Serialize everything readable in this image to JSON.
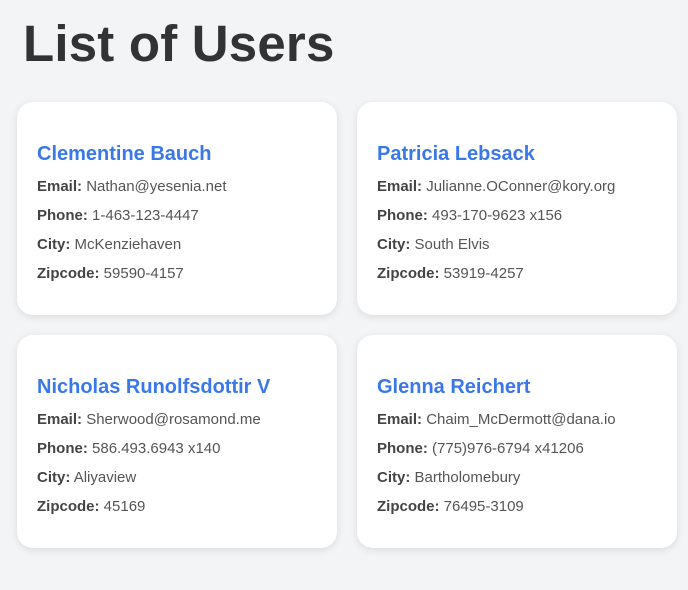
{
  "page": {
    "title": "List of Users"
  },
  "labels": {
    "email": "Email:",
    "phone": "Phone:",
    "city": "City:",
    "zipcode": "Zipcode:"
  },
  "users": [
    {
      "name": "Clementine Bauch",
      "email": "Nathan@yesenia.net",
      "phone": "1-463-123-4447",
      "city": "McKenziehaven",
      "zipcode": "59590-4157"
    },
    {
      "name": "Patricia Lebsack",
      "email": "Julianne.OConner@kory.org",
      "phone": "493-170-9623 x156",
      "city": "South Elvis",
      "zipcode": "53919-4257"
    },
    {
      "name": "Nicholas Runolfsdottir V",
      "email": "Sherwood@rosamond.me",
      "phone": "586.493.6943 x140",
      "city": "Aliyaview",
      "zipcode": "45169"
    },
    {
      "name": "Glenna Reichert",
      "email": "Chaim_McDermott@dana.io",
      "phone": "(775)976-6794 x41206",
      "city": "Bartholomebury",
      "zipcode": "76495-3109"
    }
  ],
  "colors": {
    "background": "#f3f4f6",
    "card": "#ffffff",
    "accent_name": "#3b78e7",
    "title_text": "#333333"
  }
}
